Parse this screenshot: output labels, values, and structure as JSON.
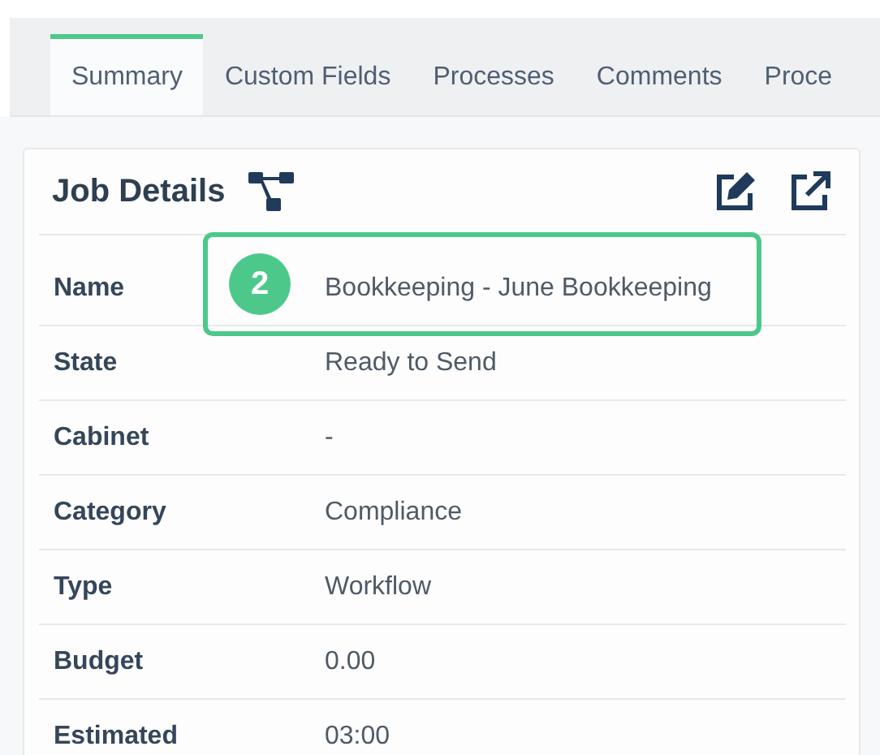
{
  "tabs": [
    {
      "label": "Summary",
      "selected": true
    },
    {
      "label": "Custom Fields",
      "selected": false
    },
    {
      "label": "Processes",
      "selected": false
    },
    {
      "label": "Comments",
      "selected": false
    },
    {
      "label": "Proce",
      "selected": false
    }
  ],
  "panel": {
    "title": "Job Details",
    "rows": [
      {
        "label": "Name",
        "value": "Bookkeeping - June Bookkeeping",
        "callout_badge": "2"
      },
      {
        "label": "State",
        "value": "Ready to Send"
      },
      {
        "label": "Cabinet",
        "value": "-"
      },
      {
        "label": "Category",
        "value": "Compliance"
      },
      {
        "label": "Type",
        "value": "Workflow"
      },
      {
        "label": "Budget",
        "value": "0.00"
      },
      {
        "label": "Estimated",
        "value": "03:00"
      }
    ]
  }
}
